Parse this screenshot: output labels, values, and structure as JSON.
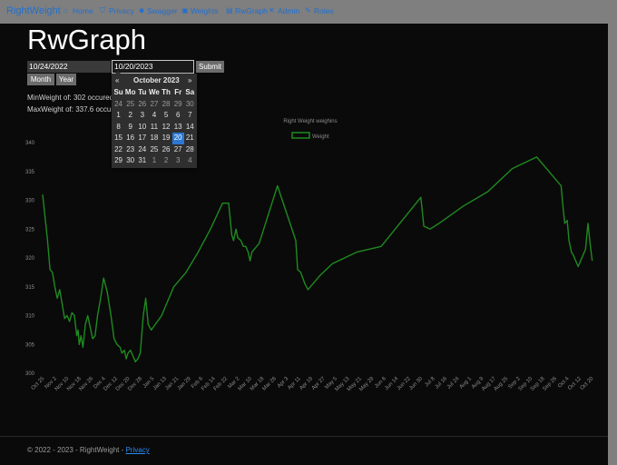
{
  "navbar": {
    "brand": "RightWeight",
    "items": [
      {
        "label": "Home",
        "icon": "home-icon",
        "glyph": "⌂"
      },
      {
        "label": "Privacy",
        "icon": "shield-icon",
        "glyph": "⛉"
      },
      {
        "label": "Swagger",
        "icon": "users-icon",
        "glyph": "☻"
      },
      {
        "label": "Weights",
        "icon": "scale-icon",
        "glyph": "▣"
      },
      {
        "label": "RwGraph",
        "icon": "file-icon",
        "glyph": "▤"
      },
      {
        "label": "Admin",
        "icon": "tools-icon",
        "glyph": "✕"
      },
      {
        "label": "Roles",
        "icon": "wrench-icon",
        "glyph": "✎"
      }
    ]
  },
  "page": {
    "title": "RwGraph",
    "start_date": "10/24/2022",
    "end_date": "10/20/2023",
    "submit_label": "Submit",
    "month_label": "Month",
    "year_label": "Year",
    "min_text": "MinWeight of: 302 occured",
    "max_text": "MaxWeight of: 337.6 occured"
  },
  "datepicker": {
    "prev": "«",
    "next": "»",
    "month_title": "October 2023",
    "days_of_week": [
      "Su",
      "Mo",
      "Tu",
      "We",
      "Th",
      "Fr",
      "Sa"
    ],
    "weeks": [
      [
        "24",
        "25",
        "26",
        "27",
        "28",
        "29",
        "30"
      ],
      [
        "1",
        "2",
        "3",
        "4",
        "5",
        "6",
        "7"
      ],
      [
        "8",
        "9",
        "10",
        "11",
        "12",
        "13",
        "14"
      ],
      [
        "15",
        "16",
        "17",
        "18",
        "19",
        "20",
        "21"
      ],
      [
        "22",
        "23",
        "24",
        "25",
        "26",
        "27",
        "28"
      ],
      [
        "29",
        "30",
        "31",
        "1",
        "2",
        "3",
        "4"
      ]
    ],
    "selected": "20"
  },
  "chart_data": {
    "type": "line",
    "title": "Right Weight weighins",
    "legend": "top",
    "series": [
      {
        "name": "Weight",
        "color": "#1f8a1f"
      }
    ],
    "ylim": [
      300,
      340
    ],
    "yticks": [
      "300",
      "305",
      "310",
      "315",
      "320",
      "325",
      "330",
      "335",
      "340"
    ],
    "xticks": [
      "Oct 25",
      "Nov 2",
      "Nov 10",
      "Nov 18",
      "Nov 26",
      "Dec 4",
      "Dec 12",
      "Dec 20",
      "Dec 28",
      "Jan 5",
      "Jan 13",
      "Jan 21",
      "Jan 29",
      "Feb 6",
      "Feb 14",
      "Feb 22",
      "Mar 2",
      "Mar 10",
      "Mar 18",
      "Mar 26",
      "Apr 3",
      "Apr 11",
      "Apr 19",
      "Apr 27",
      "May 5",
      "May 13",
      "May 21",
      "May 29",
      "Jun 6",
      "Jun 14",
      "Jun 22",
      "Jun 30",
      "Jul 8",
      "Jul 16",
      "Jul 24",
      "Aug 1",
      "Aug 9",
      "Aug 17",
      "Aug 25",
      "Sep 2",
      "Sep 10",
      "Sep 18",
      "Sep 26",
      "Oct 4",
      "Oct 12",
      "Oct 20"
    ],
    "points": [
      [
        0,
        331
      ],
      [
        0.4,
        327
      ],
      [
        0.8,
        323
      ],
      [
        1.2,
        318
      ],
      [
        1.6,
        317.5
      ],
      [
        2.0,
        315
      ],
      [
        2.4,
        313
      ],
      [
        2.8,
        314.5
      ],
      [
        3.2,
        312
      ],
      [
        3.6,
        309.5
      ],
      [
        4,
        310
      ],
      [
        4.4,
        309
      ],
      [
        4.8,
        310.5
      ],
      [
        5.2,
        310
      ],
      [
        5.6,
        306.5
      ],
      [
        5.8,
        307.5
      ],
      [
        6.0,
        305
      ],
      [
        6.3,
        306.5
      ],
      [
        6.6,
        304.5
      ],
      [
        7,
        308.5
      ],
      [
        7.4,
        310
      ],
      [
        7.8,
        308
      ],
      [
        8.2,
        306
      ],
      [
        8.6,
        306.5
      ],
      [
        9.0,
        310
      ],
      [
        9.5,
        313
      ],
      [
        10,
        316.5
      ],
      [
        10.6,
        314
      ],
      [
        11.2,
        310
      ],
      [
        11.7,
        306
      ],
      [
        12.2,
        305
      ],
      [
        12.7,
        304.5
      ],
      [
        13.0,
        303.5
      ],
      [
        13.4,
        304
      ],
      [
        13.7,
        302.5
      ],
      [
        14.0,
        303.5
      ],
      [
        14.4,
        304
      ],
      [
        14.8,
        303
      ],
      [
        15.2,
        302
      ],
      [
        15.6,
        302.5
      ],
      [
        16.0,
        303.5
      ],
      [
        16.5,
        310
      ],
      [
        16.9,
        313
      ],
      [
        17.3,
        308.5
      ],
      [
        17.8,
        307.5
      ],
      [
        19.5,
        310
      ],
      [
        21.5,
        315
      ],
      [
        23.5,
        317.5
      ],
      [
        25.5,
        321
      ],
      [
        27.5,
        325
      ],
      [
        29.5,
        329.5
      ],
      [
        30.5,
        329.5
      ],
      [
        31,
        324
      ],
      [
        31.3,
        323
      ],
      [
        31.7,
        325
      ],
      [
        32.0,
        323.5
      ],
      [
        32.5,
        323
      ],
      [
        32.9,
        322
      ],
      [
        33.3,
        322
      ],
      [
        33.7,
        321
      ],
      [
        34.0,
        319.5
      ],
      [
        34.3,
        321
      ],
      [
        35.5,
        322.5
      ],
      [
        38.5,
        332.5
      ],
      [
        41.5,
        323
      ],
      [
        41.8,
        318
      ],
      [
        42.3,
        317.5
      ],
      [
        43,
        315.5
      ],
      [
        43.5,
        314.5
      ],
      [
        45.5,
        317
      ],
      [
        47.5,
        319
      ],
      [
        51.5,
        321
      ],
      [
        55.5,
        322
      ],
      [
        62,
        330.5
      ],
      [
        62.5,
        325.5
      ],
      [
        63.5,
        325
      ],
      [
        65,
        326
      ],
      [
        69,
        329
      ],
      [
        73,
        331.5
      ],
      [
        77,
        335.5
      ],
      [
        81,
        337.5
      ],
      [
        85,
        332.5
      ],
      [
        85.3,
        329
      ],
      [
        85.6,
        326
      ],
      [
        86,
        326.5
      ],
      [
        86.3,
        323
      ],
      [
        86.7,
        321
      ],
      [
        87,
        320.5
      ],
      [
        87.4,
        319.5
      ],
      [
        87.8,
        318.5
      ],
      [
        88.2,
        319.5
      ],
      [
        88.6,
        320.5
      ],
      [
        89,
        321.5
      ],
      [
        89.4,
        326
      ],
      [
        89.8,
        322
      ],
      [
        90.1,
        319.5
      ]
    ]
  },
  "footer": {
    "text": "© 2022 - 2023 - RightWeight - ",
    "link": "Privacy"
  }
}
